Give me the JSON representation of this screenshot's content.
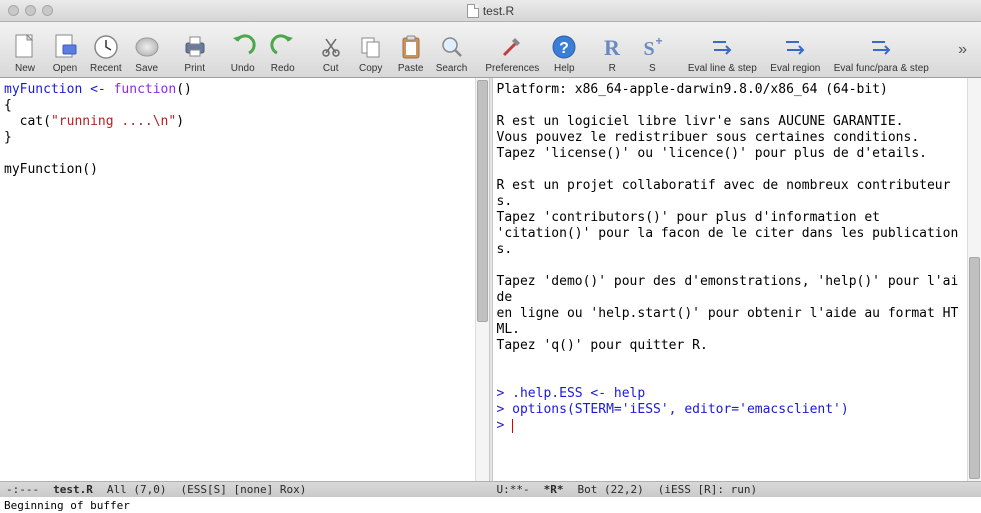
{
  "window": {
    "title": "test.R"
  },
  "toolbar": {
    "new": "New",
    "open": "Open",
    "recent": "Recent",
    "save": "Save",
    "print": "Print",
    "undo": "Undo",
    "redo": "Redo",
    "cut": "Cut",
    "copy": "Copy",
    "paste": "Paste",
    "search": "Search",
    "preferences": "Preferences",
    "help": "Help",
    "r": "R",
    "s": "S",
    "eval_line": "Eval line & step",
    "eval_region": "Eval region",
    "eval_func": "Eval func/para & step"
  },
  "editor": {
    "line1_part1": "myFunction",
    "line1_op": " <- ",
    "line1_fn": "function",
    "line1_paren": "()",
    "line2": "{",
    "line3_indent": "  cat(",
    "line3_str": "\"running ....\\n\"",
    "line3_end": ")",
    "line4": "}",
    "line5": "",
    "line6": "myFunction()"
  },
  "console": {
    "l1": "Platform: x86_64-apple-darwin9.8.0/x86_64 (64-bit)",
    "l2": "",
    "l3": "R est un logiciel libre livr'e sans AUCUNE GARANTIE.",
    "l4": "Vous pouvez le redistribuer sous certaines conditions.",
    "l5": "Tapez 'license()' ou 'licence()' pour plus de d'etails.",
    "l6": "",
    "l7": "R est un projet collaboratif avec de nombreux contributeurs.",
    "l8": "Tapez 'contributors()' pour plus d'information et",
    "l9": "'citation()' pour la facon de le citer dans les publications.",
    "l10": "",
    "l11": "Tapez 'demo()' pour des d'emonstrations, 'help()' pour l'aide",
    "l12": "en ligne ou 'help.start()' pour obtenir l'aide au format HTML.",
    "l13": "Tapez 'q()' pour quitter R.",
    "l14": "",
    "l15": "",
    "l16": "> .help.ESS <- help",
    "l17": "> options(STERM='iESS', editor='emacsclient')",
    "l18": "> "
  },
  "modeline_left": {
    "flags": "-:---",
    "buffer": "test.R",
    "pos": "All (7,0)",
    "modes": "(ESS[S] [none] Rox)"
  },
  "modeline_right": {
    "flags": "U:**-",
    "buffer": "*R*",
    "pos": "Bot (22,2)",
    "modes": "(iESS [R]: run)"
  },
  "echo_area": "Beginning of buffer"
}
